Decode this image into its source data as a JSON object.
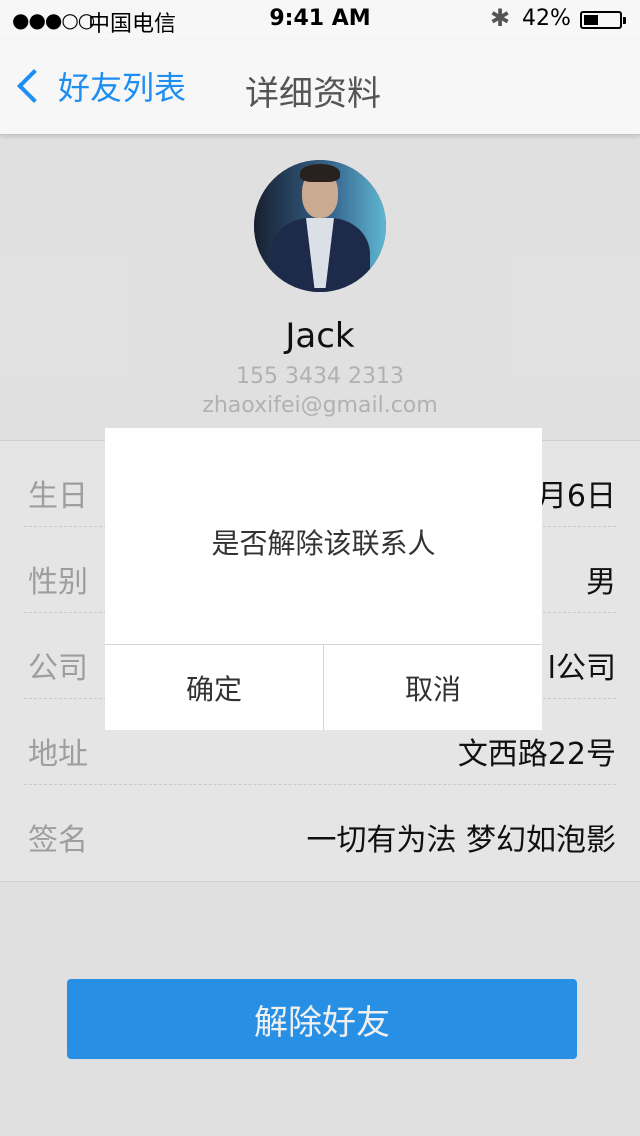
{
  "status_bar": {
    "signal": "●●●○○",
    "carrier": "中国电信",
    "time": "9:41 AM",
    "bluetooth_icon": "bluetooth-icon",
    "battery_percent": "42%",
    "battery_level": 0.42
  },
  "nav": {
    "back_label": "好友列表",
    "title": "详细资料"
  },
  "profile": {
    "name": "Jack",
    "phone": "155 3434 2313",
    "email": "zhaoxifei@gmail.com"
  },
  "details": {
    "rows": [
      {
        "label": "生日",
        "value": "月6日"
      },
      {
        "label": "性别",
        "value": "男"
      },
      {
        "label": "公司",
        "value": "l公司"
      },
      {
        "label": "地址",
        "value": "文西路22号"
      },
      {
        "label": "签名",
        "value": "一切有为法 梦幻如泡影"
      }
    ]
  },
  "dialog": {
    "message": "是否解除该联系人",
    "confirm_label": "确定",
    "cancel_label": "取消"
  },
  "actions": {
    "unfriend_label": "解除好友"
  },
  "colors": {
    "accent": "#1f8ef1",
    "button_bg": "#2b9af3",
    "page_bg": "#efefef"
  }
}
